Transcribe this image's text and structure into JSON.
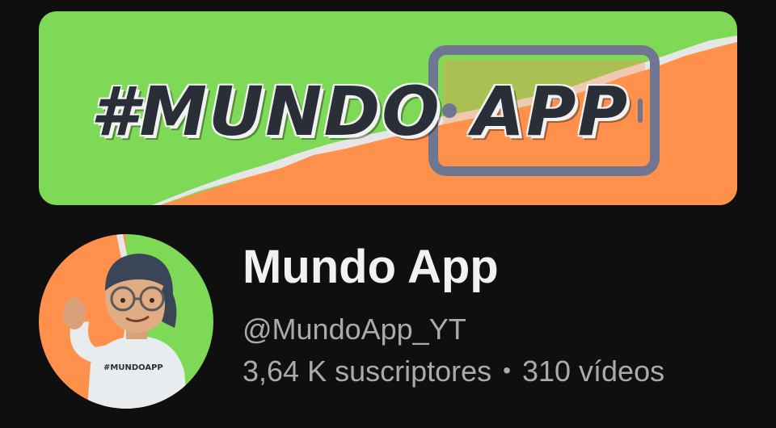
{
  "banner": {
    "word_left": "#MUNDO",
    "word_right": "APP",
    "colors": {
      "green": "#7ed957",
      "orange": "#ff914d",
      "phone": "#6e7691",
      "text": "#2a2e36"
    },
    "icon": "smartphone-icon"
  },
  "avatar": {
    "shirt_text": "#MUNDOAPP",
    "colors": {
      "left": "#ff914d",
      "right": "#7ed957"
    }
  },
  "channel": {
    "name": "Mundo App",
    "handle": "@MundoApp_YT",
    "subscribers": "3,64 K suscriptores",
    "separator": "•",
    "videos": "310 vídeos"
  }
}
